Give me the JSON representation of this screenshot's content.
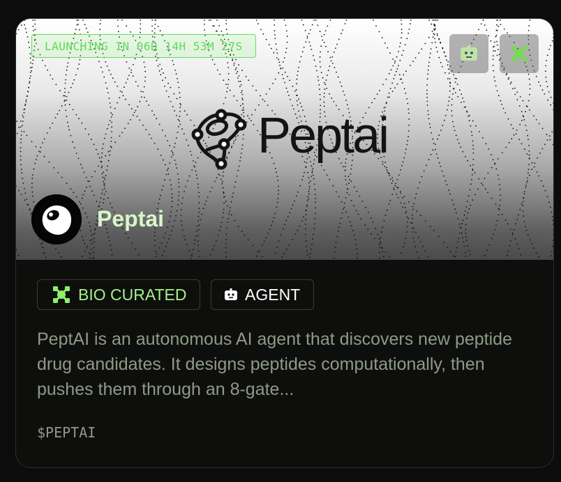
{
  "card": {
    "countdown": "LAUNCHING IN 06D 14H 53M 27S",
    "logo_text": "Peptai",
    "project_name": "Peptai",
    "tags": [
      {
        "label": "BIO CURATED",
        "icon": "bio-icon"
      },
      {
        "label": "AGENT",
        "icon": "robot-icon"
      }
    ],
    "description": "PeptAI is an autonomous AI agent that discovers new peptide drug candidates. It designs peptides computationally, then pushes them through an 8-gate...",
    "ticker": "$PEPTAI"
  },
  "colors": {
    "page_background": "#0b0c0b",
    "card_background": "#0e0f0d",
    "accent_green": "#a3f08a",
    "countdown_green": "#5fd95a",
    "muted_text": "#8e9a87",
    "name_color": "#d8f7c8"
  },
  "icons": {
    "robot_button": "robot-icon",
    "bio_button": "bio-icon"
  }
}
